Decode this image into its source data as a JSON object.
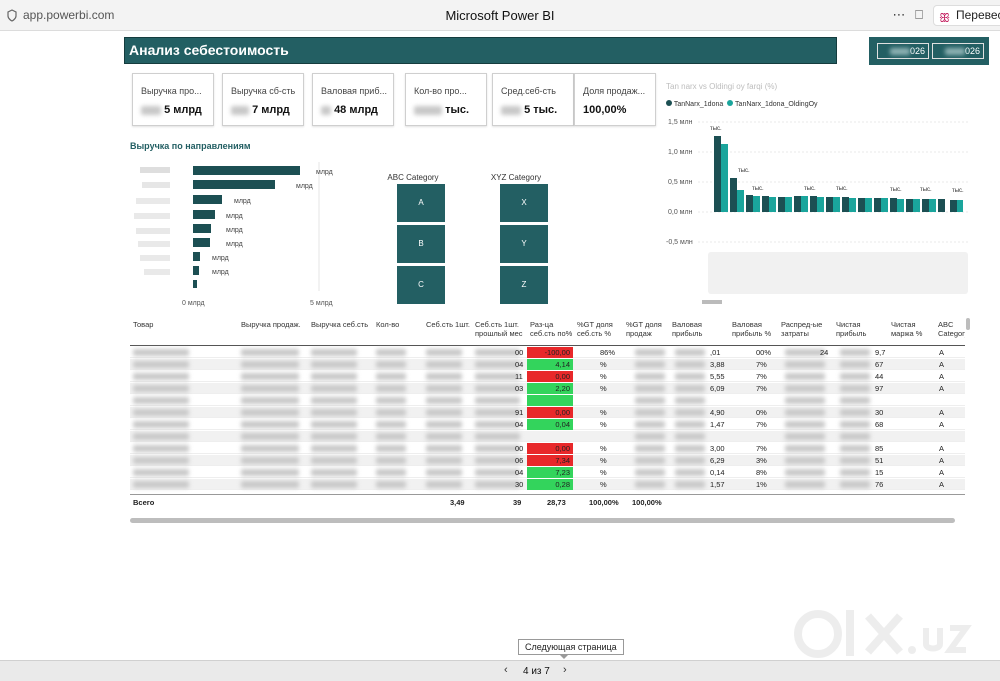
{
  "browser": {
    "url": "app.powerbi.com",
    "title": "Microsoft Power BI",
    "translate_label": "Перевест"
  },
  "report": {
    "title": "Анализ себестоимость",
    "date_chips": [
      "026",
      "026"
    ],
    "kpis": [
      {
        "label": "Выручка про...",
        "value": "5 млрд"
      },
      {
        "label": "Выручка сб-сть",
        "value": "7 млрд"
      },
      {
        "label": "Валовая приб...",
        "value": "48 млрд"
      },
      {
        "label": "Кол-во про...",
        "value": "тыс."
      },
      {
        "label": "Сред.себ-сть",
        "value": "5 тыс."
      },
      {
        "label": "Доля продаж...",
        "value": "100,00%"
      }
    ],
    "bar_section_title": "Выручка по направлениям",
    "bar_values": [
      "млрд",
      "млрд",
      "млрд",
      "млрд",
      "млрд",
      "млрд",
      "млрд",
      "млрд"
    ],
    "bar_axis": [
      "0 млрд",
      "5 млрд"
    ],
    "abc": {
      "title": "ABC Category",
      "cells": [
        "A",
        "B",
        "C"
      ]
    },
    "xyz": {
      "title": "XYZ Category",
      "cells": [
        "X",
        "Y",
        "Z"
      ]
    },
    "combo": {
      "title": "Tan narx vs Oldingi oy farqi (%)",
      "legend": [
        "TanNarx_1dona",
        "TanNarx_1dona_OldingOy"
      ],
      "legend_colors": [
        "#1c4f53",
        "#1aa59c"
      ],
      "y_ticks": [
        "1,5 млн",
        "1,0 млн",
        "0,5 млн",
        "0,0 млн",
        "-0,5 млн"
      ],
      "labels": [
        "тыс.",
        "тыс.",
        "тыс.",
        "тыс.",
        "тыс.",
        "тыс.",
        "тыс.",
        "тыс."
      ]
    },
    "table": {
      "headers": [
        "Товар",
        "Выручка продаж.",
        "Выручка себ.сть",
        "Кол-во",
        "Себ.сть 1шт.",
        "Себ.сть 1шт. прошлый мес",
        "Раз-ца себ.сть по%",
        "%GT доля себ.сть %",
        "%GT доля продаж",
        "Валовая прибыль",
        "Валовая прибыль %",
        "Распред-ые затраты",
        "Чистая прибыль",
        "Чистая маржа %",
        "ABC Category"
      ],
      "rows": [
        {
          "razn": "-100,00",
          "color": "red",
          "gt1": "86%",
          "vp": ",01",
          "vpp": "00%",
          "rz": "24",
          "np": "9,7",
          "abc": "A",
          "extra": "7",
          "c5": "00"
        },
        {
          "razn": "4,14",
          "color": "green",
          "gt1": "%",
          "vp": "3,88",
          "vpp": "7%",
          "rz": "",
          "np": "67",
          "abc": "A",
          "extra": "",
          "c5": "04"
        },
        {
          "razn": "0,00",
          "color": "red",
          "gt1": "%",
          "vp": "5,55",
          "vpp": "7%",
          "rz": "",
          "np": "44",
          "abc": "A",
          "extra": "",
          "c5": "11"
        },
        {
          "razn": "2,20",
          "color": "green",
          "gt1": "%",
          "vp": "6,09",
          "vpp": "7%",
          "rz": "",
          "np": "97",
          "abc": "A",
          "extra": "",
          "c5": "03"
        },
        {
          "razn": "",
          "color": "green",
          "gt1": "",
          "vp": "",
          "vpp": "",
          "rz": "",
          "np": "",
          "abc": "",
          "extra": "",
          "c5": ""
        },
        {
          "razn": "0,00",
          "color": "red",
          "gt1": "%",
          "vp": "4,90",
          "vpp": "0%",
          "rz": "",
          "np": "30",
          "abc": "A",
          "extra": "",
          "c5": "91"
        },
        {
          "razn": "0,04",
          "color": "green",
          "gt1": "%",
          "vp": "1,47",
          "vpp": "7%",
          "rz": "",
          "np": "68",
          "abc": "A",
          "extra": "",
          "c5": "04"
        },
        {
          "razn": "",
          "color": "none",
          "gt1": "",
          "vp": "",
          "vpp": "",
          "rz": "",
          "np": "",
          "abc": "",
          "extra": "",
          "c5": ""
        },
        {
          "razn": "0,00",
          "color": "red",
          "gt1": "%",
          "vp": "3,00",
          "vpp": "7%",
          "rz": "",
          "np": "85",
          "abc": "A",
          "extra": "",
          "c5": "00"
        },
        {
          "razn": "7,34",
          "color": "red",
          "gt1": "%",
          "vp": "6,29",
          "vpp": "3%",
          "rz": "",
          "np": "51",
          "abc": "A",
          "extra": "",
          "c5": "06"
        },
        {
          "razn": "7,23",
          "color": "green",
          "gt1": "%",
          "vp": "0,14",
          "vpp": "8%",
          "rz": "",
          "np": "15",
          "abc": "A",
          "extra": "",
          "c5": "04"
        },
        {
          "razn": "0,28",
          "color": "green",
          "gt1": "%",
          "vp": "1,57",
          "vpp": "1%",
          "rz": "",
          "np": "76",
          "abc": "A",
          "extra": "",
          "c5": "30"
        }
      ],
      "total": {
        "label": "Всего",
        "c5": "3,49",
        "c6": "39",
        "razn": "28,73",
        "gt1": "100,00%",
        "gt2": "100,00%"
      }
    }
  },
  "pager": {
    "tooltip": "Следующая страница",
    "indicator": "4 из 7",
    "prev": "‹",
    "next": "›"
  }
}
